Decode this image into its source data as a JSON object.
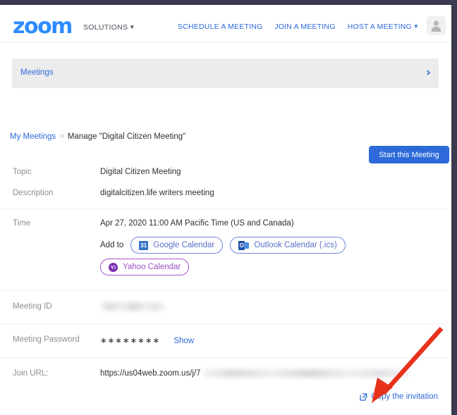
{
  "browser": {
    "chrome_color": "#3b3b4f"
  },
  "header": {
    "logo": "zoom",
    "logo_color": "#2d8cff",
    "solutions_label": "SOLUTIONS",
    "nav_links": [
      {
        "label": "SCHEDULE A MEETING",
        "caret": false
      },
      {
        "label": "JOIN A MEETING",
        "caret": false
      },
      {
        "label": "HOST A MEETING",
        "caret": true
      }
    ],
    "avatar_icon": "user-avatar-icon",
    "link_color": "#2d69d8"
  },
  "banner": {
    "label": "Meetings",
    "chevron": "›",
    "background": "#ececec"
  },
  "breadcrumb": {
    "root": "My Meetings",
    "separator": ">",
    "current": "Manage \"Digital Citizen Meeting\""
  },
  "actions": {
    "start_meeting": "Start this Meeting",
    "start_meeting_color": "#2d69d8"
  },
  "details": {
    "topic": {
      "label": "Topic",
      "value": "Digital Citizen Meeting"
    },
    "description": {
      "label": "Description",
      "value": "digitalcitizen.life writers meeting"
    },
    "time": {
      "label": "Time",
      "value": "Apr 27, 2020 11:00 AM Pacific Time (US and Canada)",
      "add_to_label": "Add to",
      "calendars": [
        {
          "name": "Google Calendar",
          "icon": "google-calendar-icon",
          "icon_text": "31",
          "accent": "#5b6ec9"
        },
        {
          "name": "Outlook Calendar (.ics)",
          "icon": "outlook-calendar-icon",
          "icon_text": "O",
          "accent": "#5b6ec9"
        },
        {
          "name": "Yahoo Calendar",
          "icon": "yahoo-calendar-icon",
          "icon_text": "Y!",
          "accent": "#9b4fc4"
        }
      ]
    },
    "meeting_id": {
      "label": "Meeting ID",
      "value": "",
      "redacted": true
    },
    "meeting_password": {
      "label": "Meeting Password",
      "masked_value": "∗∗∗∗∗∗∗∗",
      "show_link": "Show"
    },
    "join_url": {
      "label": "Join URL:",
      "value_prefix": "https://us04web.zoom.us/j/7",
      "redacted_tail": true
    }
  },
  "copy_invitation": {
    "label": "Copy the invitation",
    "icon": "external-link-icon"
  },
  "annotation": {
    "arrow_color": "#e8321b",
    "points_to": "Copy the invitation"
  }
}
